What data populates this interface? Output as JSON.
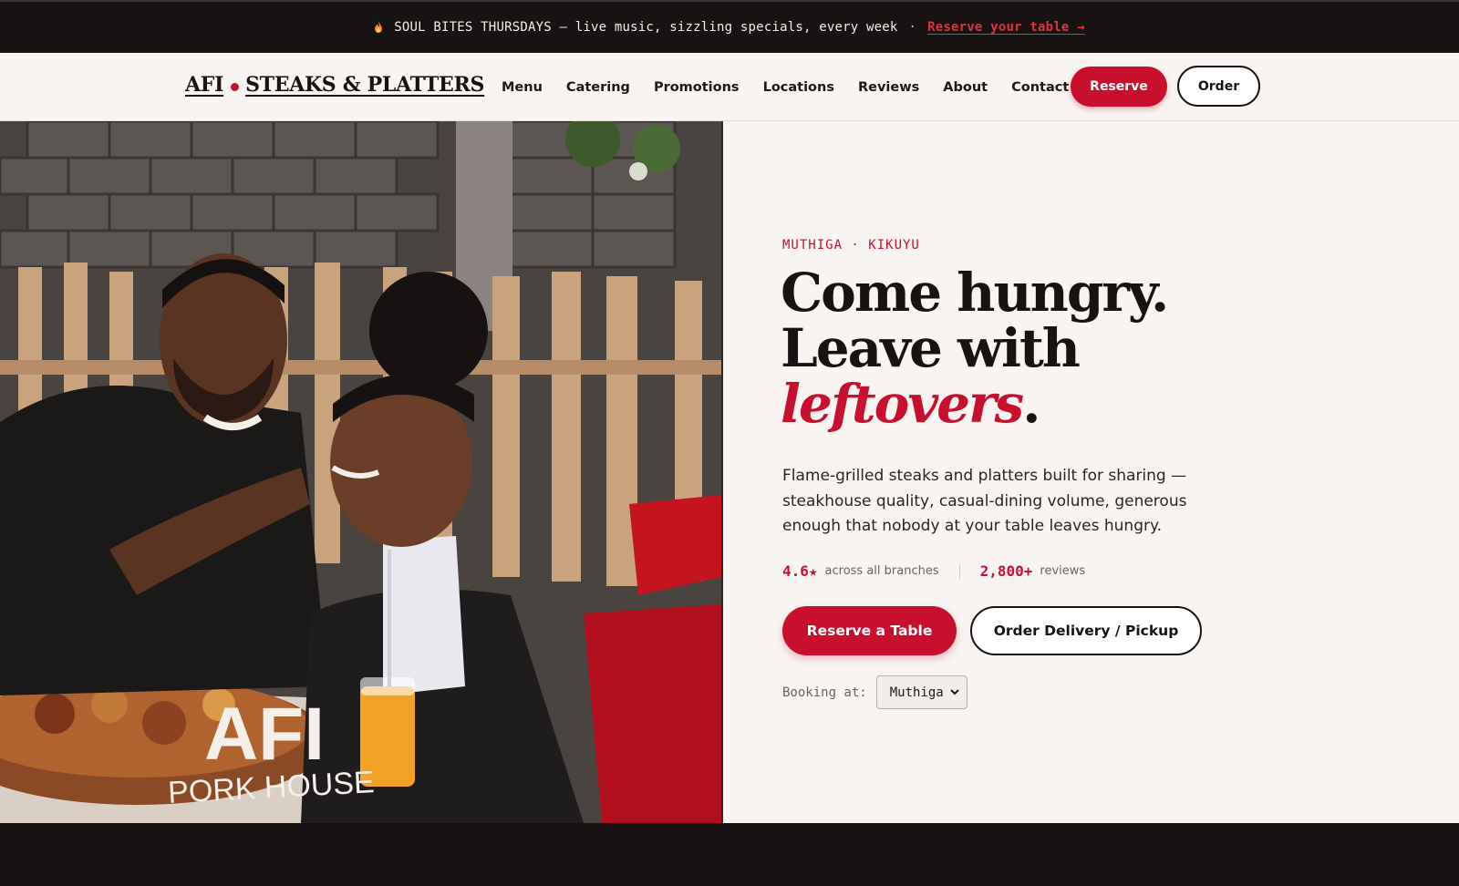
{
  "announcement": {
    "icon": "flame-icon",
    "text": "SOUL BITES THURSDAYS — live music, sizzling specials, every week",
    "separator": "·",
    "link": "Reserve your table →"
  },
  "brand": {
    "name_left": "AFI",
    "name_right": "STEAKS & PLATTERS",
    "accent_color": "#c8102e"
  },
  "nav": {
    "links": [
      "Menu",
      "Catering",
      "Promotions",
      "Locations",
      "Reviews",
      "About",
      "Contact"
    ],
    "reserve_label": "Reserve",
    "order_label": "Order"
  },
  "hero": {
    "image_overlay_top": "AFI",
    "image_overlay_bottom": "PORK HOUSE",
    "eyebrow": "MUTHIGA · KIKUYU",
    "headline_line1": "Come hungry.",
    "headline_line2": "Leave with",
    "headline_accent": "leftovers",
    "headline_end": ".",
    "description": "Flame-grilled steaks and platters built for sharing — steakhouse quality, casual-dining volume, generous enough that nobody at your table leaves hungry.",
    "stats": [
      {
        "value": "4.6★",
        "label": "across all branches"
      },
      {
        "value": "2,800+",
        "label": "reviews"
      }
    ],
    "primary_cta": "Reserve a Table",
    "secondary_cta": "Order Delivery / Pickup",
    "booking_label": "Booking at:",
    "booking_selected": "Muthiga"
  }
}
